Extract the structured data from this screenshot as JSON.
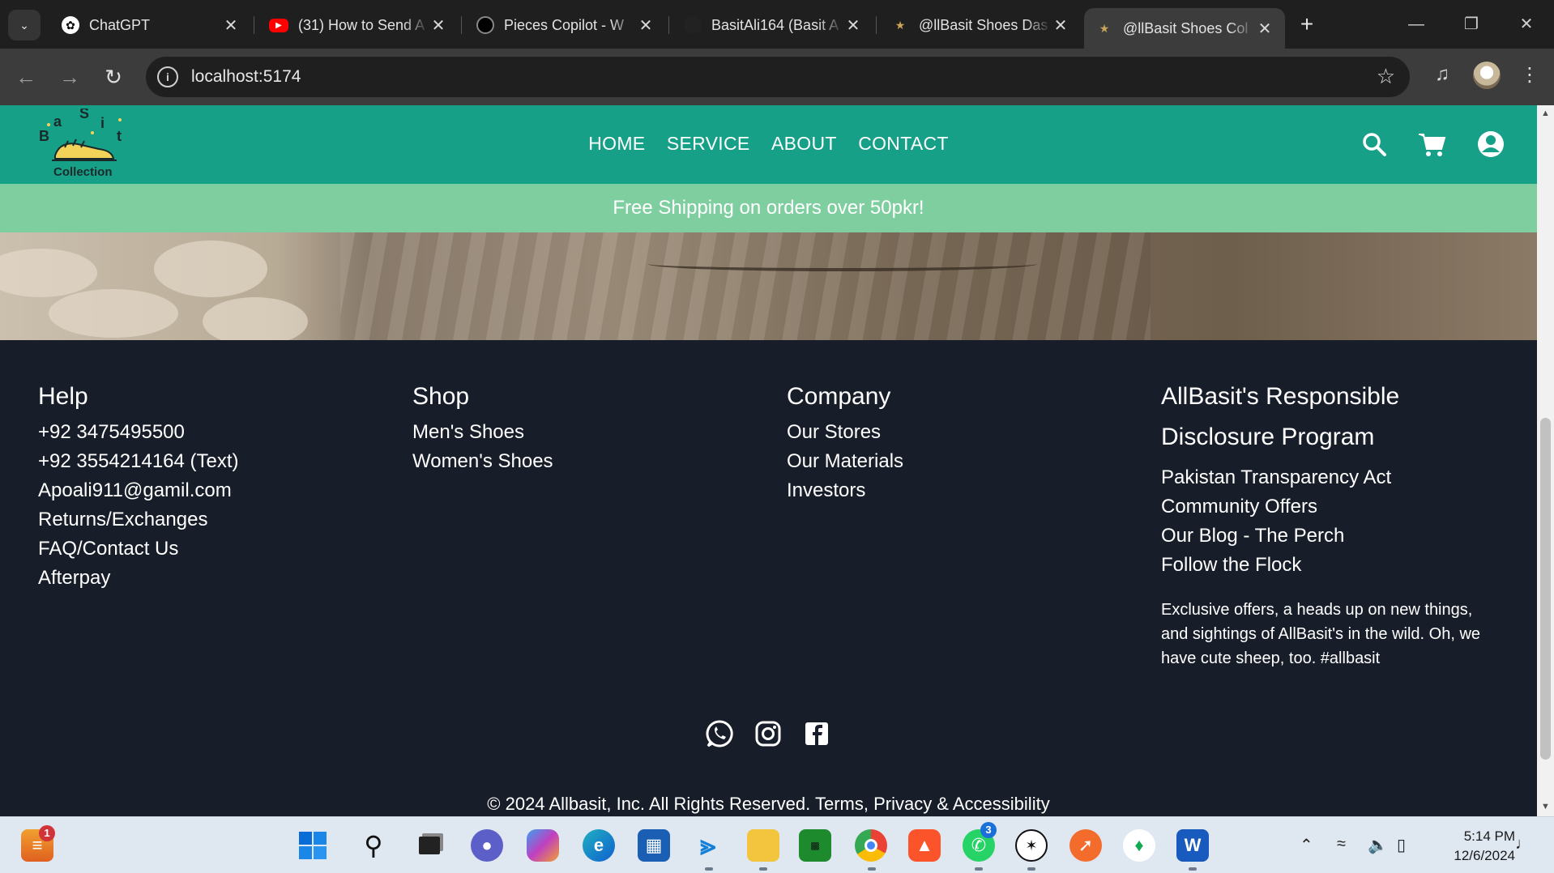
{
  "browser": {
    "tabs": [
      {
        "title": "ChatGPT",
        "favicon": "chatgpt-icon"
      },
      {
        "title": "(31) How to Send A",
        "favicon": "youtube-icon"
      },
      {
        "title": "Pieces Copilot - W",
        "favicon": "pieces-icon"
      },
      {
        "title": "BasitAli164 (Basit A",
        "favicon": "github-icon"
      },
      {
        "title": "@llBasit Shoes Das",
        "favicon": "basit-logo-icon"
      },
      {
        "title": "@llBasit Shoes Col",
        "favicon": "basit-logo-icon"
      }
    ],
    "active_tab": 5,
    "url": "localhost:5174"
  },
  "site": {
    "logo_text": "Collection",
    "logo_letters": [
      "B",
      "a",
      "S",
      "i",
      "t"
    ],
    "nav": [
      "HOME",
      "SERVICE",
      "ABOUT",
      "CONTACT"
    ],
    "promo": "Free Shipping on orders over 50pkr!",
    "colors": {
      "header": "#17a088",
      "promo": "#7ecea0",
      "footer": "#181e29"
    }
  },
  "footer": {
    "help": {
      "title": "Help",
      "links": [
        "+92 3475495500",
        "+92 3554214164 (Text)",
        "Apoali911@gamil.com",
        "Returns/Exchanges",
        "FAQ/Contact Us",
        "Afterpay"
      ]
    },
    "shop": {
      "title": "Shop",
      "links": [
        "Men's Shoes",
        "Women's Shoes"
      ]
    },
    "company": {
      "title": "Company",
      "links": [
        "Our Stores",
        "Our Materials",
        "Investors"
      ]
    },
    "program": {
      "title_line1": "AllBasit's Responsible",
      "title_line2": "Disclosure Program",
      "links": [
        "Pakistan Transparency Act",
        "Community Offers",
        "Our Blog - The Perch",
        "Follow the Flock"
      ],
      "blurb": "Exclusive offers, a heads up on new things, and sightings of AllBasit's in the wild. Oh, we have cute sheep, too. #allbasit"
    },
    "socials": [
      "whatsapp-icon",
      "instagram-icon",
      "facebook-icon"
    ],
    "copyright": "© 2024 Allbasit, Inc. All Rights Reserved. Terms, Privacy & Accessibility"
  },
  "taskbar": {
    "time": "5:14 PM",
    "date": "12/6/2024",
    "badges": {
      "widgets": "1",
      "whatsapp": "3"
    }
  }
}
